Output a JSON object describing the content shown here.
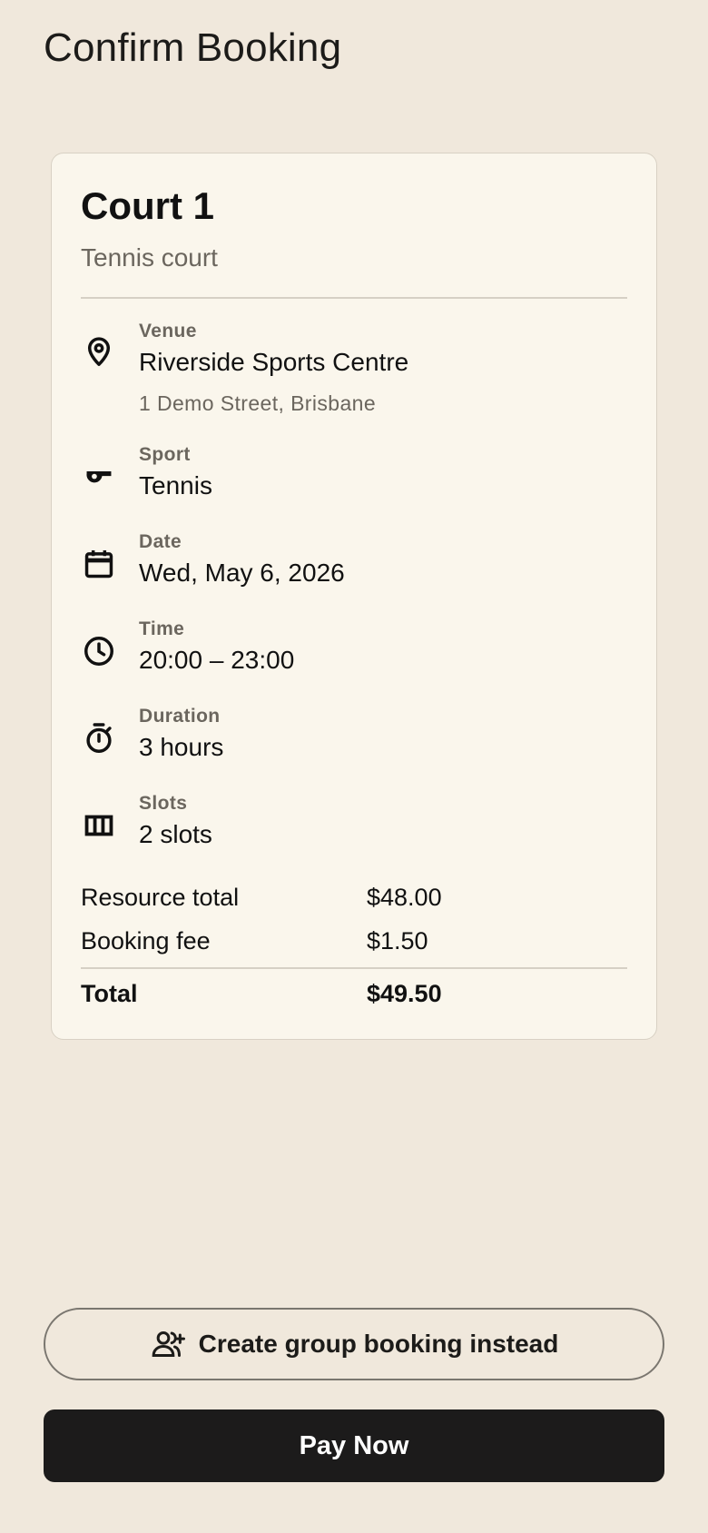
{
  "header": {
    "title": "Confirm Booking"
  },
  "resource": {
    "name": "Court 1",
    "type": "Tennis court"
  },
  "details": [
    {
      "icon": "location-pin-icon",
      "label": "Venue",
      "value": "Riverside Sports Centre",
      "sub": "1 Demo Street, Brisbane"
    },
    {
      "icon": "whistle-icon",
      "label": "Sport",
      "value": "Tennis"
    },
    {
      "icon": "calendar-icon",
      "label": "Date",
      "value": "Wed, May 6, 2026"
    },
    {
      "icon": "clock-icon",
      "label": "Time",
      "value": "20:00 – 23:00"
    },
    {
      "icon": "stopwatch-icon",
      "label": "Duration",
      "value": "3 hours"
    },
    {
      "icon": "slots-icon",
      "label": "Slots",
      "value": "2 slots"
    }
  ],
  "pricing": {
    "resource_total_label": "Resource total",
    "resource_total": "$48.00",
    "booking_fee_label": "Booking fee",
    "booking_fee": "$1.50",
    "total_label": "Total",
    "total": "$49.50"
  },
  "actions": {
    "group_booking_label": "Create group booking instead",
    "group_booking_icon": "add-group-icon",
    "pay_label": "Pay Now"
  }
}
